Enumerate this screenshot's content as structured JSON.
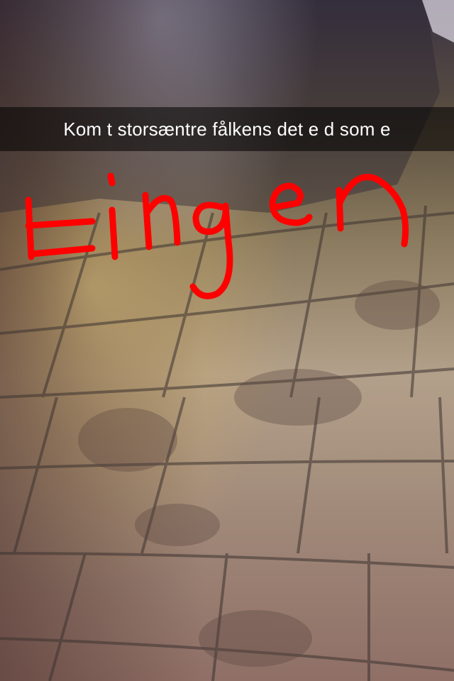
{
  "snap": {
    "caption": "Kom t storsæntre fålkens det e d som e",
    "drawing": {
      "word": "tingen",
      "color": "#ff0000"
    }
  }
}
